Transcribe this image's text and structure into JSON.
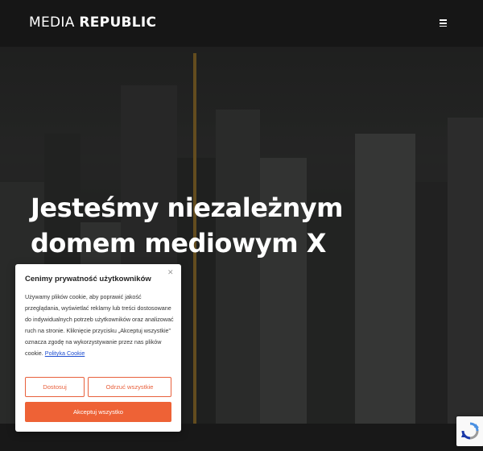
{
  "header": {
    "logo_light": "MEDIA",
    "logo_bold": "REPUBLIC",
    "menu_icon": "hamburger-menu-icon"
  },
  "hero": {
    "title": "Jesteśmy niezależnym domem mediowym X",
    "background": "aerial-city-skyline"
  },
  "cookie_banner": {
    "title": "Cenimy prywatność użytkowników",
    "close_icon": "close-icon",
    "body": "Używamy plików cookie, aby poprawić jakość przeglądania, wyświetlać reklamy lub treści dostosowane do indywidualnych potrzeb użytkowników oraz analizować ruch na stronie. Kliknięcie przycisku „Akceptuj wszystkie” oznacza zgodę na wykorzystywanie przez nas plików cookie.",
    "link_text": "Polityka Cookie",
    "customize_label": "Dostosuj",
    "reject_label": "Odrzuć wszystkie",
    "accept_label": "Akceptuj wszystko"
  },
  "recaptcha": {
    "icon": "recaptcha-icon"
  },
  "colors": {
    "accent": "#ee6236",
    "link": "#1f4fd1",
    "header_bg": "#161616"
  }
}
